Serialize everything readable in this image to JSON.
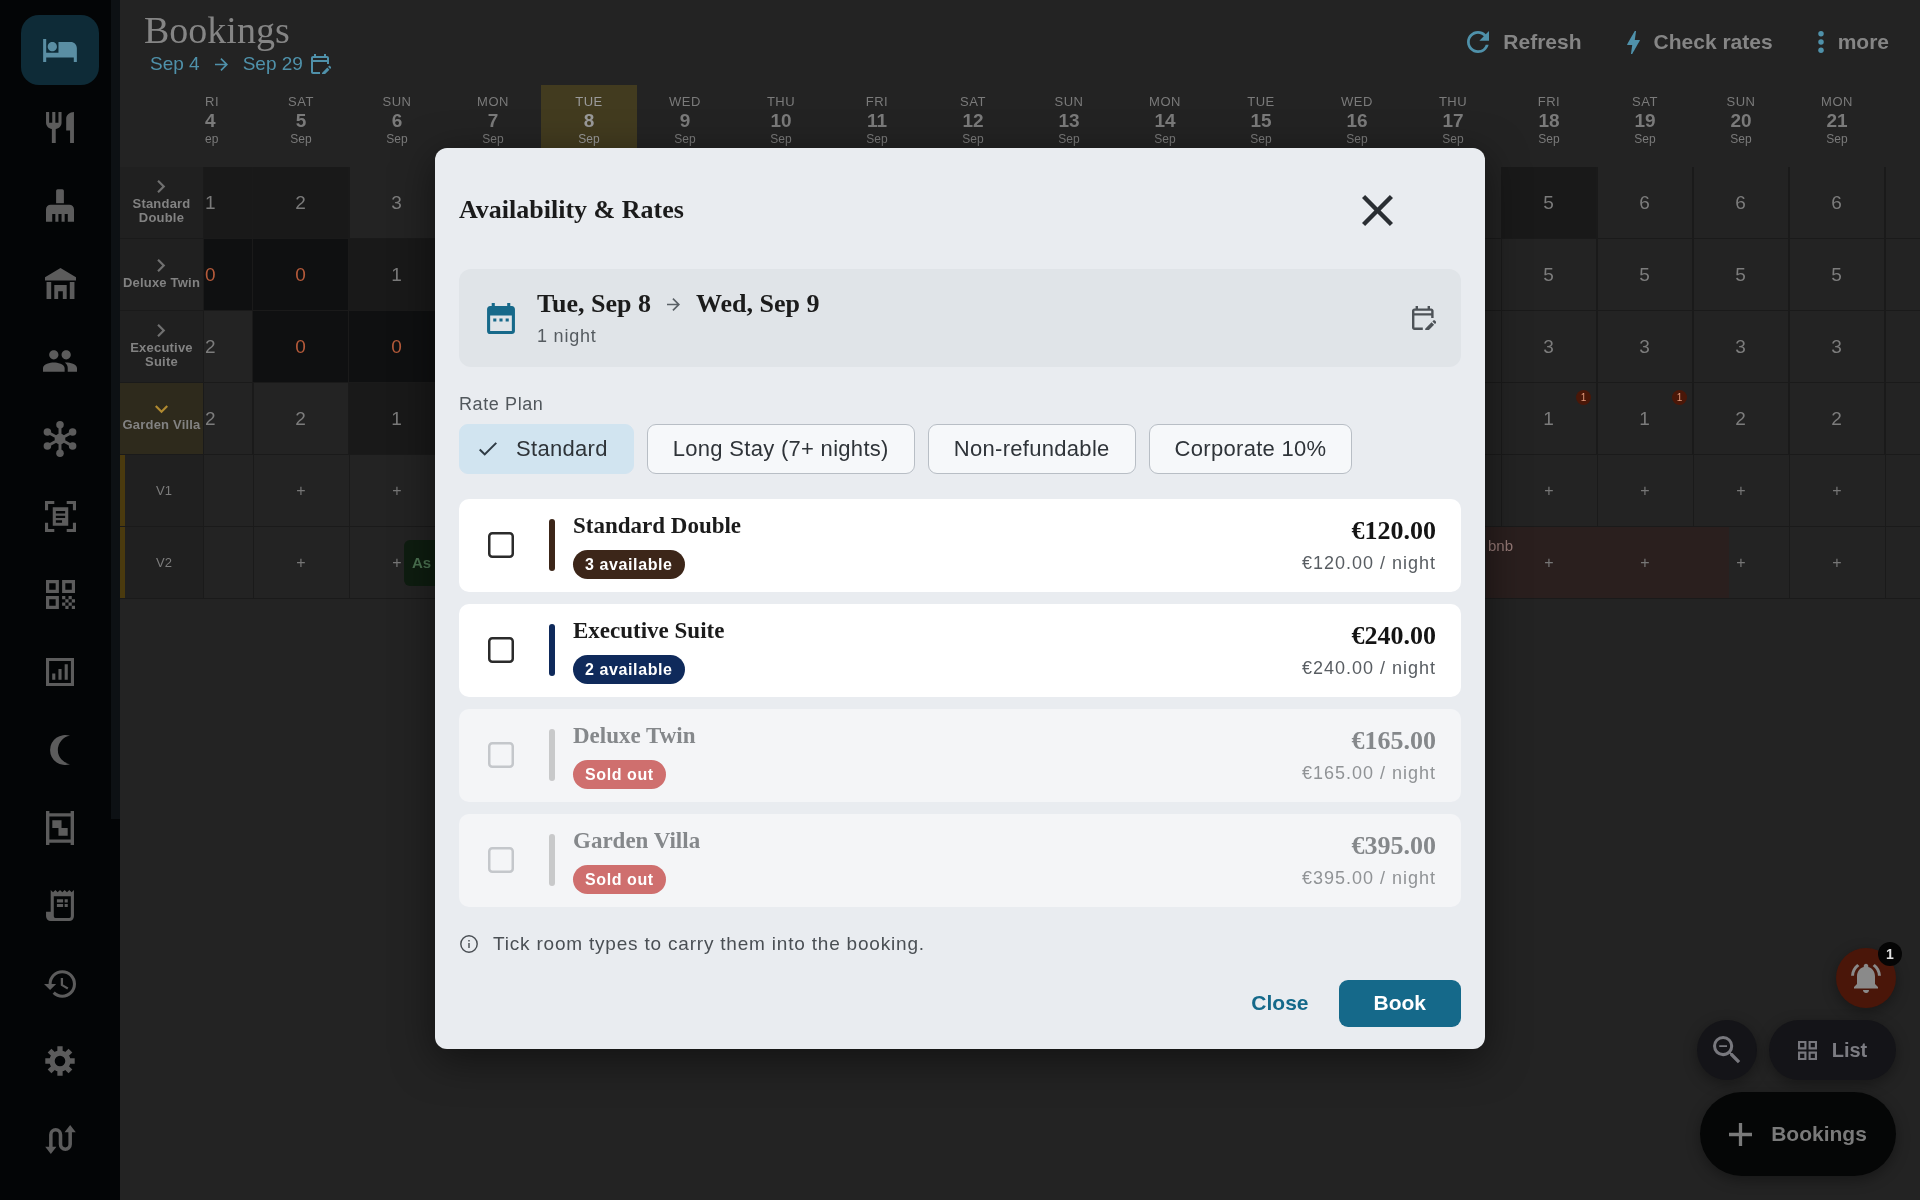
{
  "sidebar": {
    "items": [
      {
        "selected": true
      },
      {
        "selected": false
      },
      {
        "selected": false
      },
      {
        "selected": false
      },
      {
        "selected": false
      },
      {
        "selected": false
      },
      {
        "selected": false
      },
      {
        "selected": false
      },
      {
        "selected": false
      },
      {
        "selected": false
      },
      {
        "selected": false
      },
      {
        "selected": false
      },
      {
        "selected": false
      },
      {
        "selected": false
      },
      {
        "selected": false
      }
    ]
  },
  "header": {
    "title": "Bookings",
    "range_start": "Sep 4",
    "range_end": "Sep 29"
  },
  "toolbar": [
    "Refresh",
    "Check rates",
    "more"
  ],
  "calendar": {
    "days": [
      {
        "weekday": "RI",
        "day": "4",
        "month": "ep",
        "today": false
      },
      {
        "weekday": "SAT",
        "day": "5",
        "month": "Sep",
        "today": false
      },
      {
        "weekday": "SUN",
        "day": "6",
        "month": "Sep",
        "today": false
      },
      {
        "weekday": "MON",
        "day": "7",
        "month": "Sep",
        "today": false
      },
      {
        "weekday": "TUE",
        "day": "8",
        "month": "Sep",
        "today": true
      },
      {
        "weekday": "WED",
        "day": "9",
        "month": "Sep",
        "today": false
      },
      {
        "weekday": "THU",
        "day": "10",
        "month": "Sep",
        "today": false
      },
      {
        "weekday": "FRI",
        "day": "11",
        "month": "Sep",
        "today": false
      },
      {
        "weekday": "SAT",
        "day": "12",
        "month": "Sep",
        "today": false
      },
      {
        "weekday": "SUN",
        "day": "13",
        "month": "Sep",
        "today": false
      },
      {
        "weekday": "MON",
        "day": "14",
        "month": "Sep",
        "today": false
      },
      {
        "weekday": "TUE",
        "day": "15",
        "month": "Sep",
        "today": false
      },
      {
        "weekday": "WED",
        "day": "16",
        "month": "Sep",
        "today": false
      },
      {
        "weekday": "THU",
        "day": "17",
        "month": "Sep",
        "today": false
      },
      {
        "weekday": "FRI",
        "day": "18",
        "month": "Sep",
        "today": false
      },
      {
        "weekday": "SAT",
        "day": "19",
        "month": "Sep",
        "today": false
      },
      {
        "weekday": "SUN",
        "day": "20",
        "month": "Sep",
        "today": false
      },
      {
        "weekday": "MON",
        "day": "21",
        "month": "Sep",
        "today": false
      }
    ],
    "rows": [
      {
        "label": "Standard Double",
        "expanded": false,
        "cells": [
          {
            "value": "1",
            "kind": "low"
          },
          {
            "value": "2",
            "kind": "low"
          },
          {
            "value": "3",
            "kind": "open"
          },
          {},
          {},
          {},
          {},
          {},
          {},
          {},
          {},
          {},
          {},
          {},
          {
            "value": "5",
            "kind": "low"
          },
          {
            "value": "6",
            "kind": "open"
          },
          {
            "value": "6",
            "kind": "open"
          },
          {
            "value": "6",
            "kind": "open"
          }
        ]
      },
      {
        "label": "Deluxe Twin",
        "expanded": false,
        "cells": [
          {
            "value": "0",
            "kind": "full"
          },
          {
            "value": "0",
            "kind": "full"
          },
          {
            "value": "1",
            "kind": "low"
          },
          {},
          {},
          {},
          {},
          {},
          {},
          {},
          {},
          {},
          {},
          {},
          {
            "value": "5",
            "kind": "open"
          },
          {
            "value": "5",
            "kind": "open"
          },
          {
            "value": "5",
            "kind": "open"
          },
          {
            "value": "5",
            "kind": "open"
          }
        ]
      },
      {
        "label": "Executive Suite",
        "expanded": false,
        "cells": [
          {
            "value": "2",
            "kind": "open"
          },
          {
            "value": "0",
            "kind": "full"
          },
          {
            "value": "0",
            "kind": "full"
          },
          {},
          {},
          {},
          {},
          {},
          {},
          {},
          {},
          {},
          {},
          {},
          {
            "value": "3",
            "kind": "open"
          },
          {
            "value": "3",
            "kind": "open"
          },
          {
            "value": "3",
            "kind": "open"
          },
          {
            "value": "3",
            "kind": "open"
          }
        ]
      },
      {
        "label": "Garden Villa",
        "expanded": true,
        "cells": [
          {
            "value": "2",
            "kind": "open"
          },
          {
            "value": "2",
            "kind": "open"
          },
          {
            "value": "1",
            "kind": "low"
          },
          {},
          {},
          {},
          {},
          {},
          {},
          {},
          {},
          {},
          {},
          {},
          {
            "value": "1",
            "kind": "open",
            "badge": "1"
          },
          {
            "value": "1",
            "kind": "open",
            "badge": "1"
          },
          {
            "value": "2",
            "kind": "open"
          },
          {
            "value": "2",
            "kind": "open"
          }
        ],
        "children": [
          {
            "label": "V1",
            "cells": [
              {},
              {
                "value": "+",
                "kind": "add"
              },
              {
                "value": "+",
                "kind": "add"
              },
              {},
              {},
              {},
              {},
              {},
              {},
              {},
              {},
              {},
              {},
              {},
              {
                "value": "+",
                "kind": "add"
              },
              {
                "value": "+",
                "kind": "add"
              },
              {
                "value": "+",
                "kind": "add"
              },
              {
                "value": "+",
                "kind": "add"
              }
            ]
          },
          {
            "label": "V2",
            "cells": [
              {},
              {
                "value": "+",
                "kind": "add"
              },
              {
                "value": "+",
                "kind": "add"
              },
              {},
              {},
              {},
              {},
              {},
              {},
              {},
              {},
              {},
              {},
              {},
              {
                "value": "+",
                "kind": "add"
              },
              {
                "value": "+",
                "kind": "add"
              },
              {
                "value": "+",
                "kind": "add"
              },
              {
                "value": "+",
                "kind": "add"
              }
            ],
            "bookings": [
              {
                "label": "As",
                "color": "#0e1d10"
              },
              {
                "label": "bnb",
                "color": "#2a1f1e"
              }
            ]
          }
        ]
      }
    ]
  },
  "dialog": {
    "title": "Availability & Rates",
    "stay": {
      "check_in": "Tue, Sep 8",
      "check_out": "Wed, Sep 9",
      "nights": "1 night"
    },
    "rate_plan": {
      "label": "Rate Plan",
      "options": [
        {
          "label": "Standard",
          "selected": true
        },
        {
          "label": "Long Stay (7+ nights)",
          "selected": false
        },
        {
          "label": "Non-refundable",
          "selected": false
        },
        {
          "label": "Corporate 10%",
          "selected": false
        }
      ]
    },
    "rooms": [
      {
        "name": "Standard Double",
        "badge": "3 available",
        "price": "€120.00",
        "per_night": "€120.00 / night",
        "color": "#3c2619",
        "checked": false,
        "disabled": false
      },
      {
        "name": "Executive Suite",
        "badge": "2 available",
        "price": "€240.00",
        "per_night": "€240.00 / night",
        "color": "#0f2a5b",
        "checked": false,
        "disabled": false
      },
      {
        "name": "Deluxe Twin",
        "badge": "Sold out",
        "price": "€165.00",
        "per_night": "€165.00 / night",
        "color": "#c8c9ca",
        "checked": false,
        "disabled": true
      },
      {
        "name": "Garden Villa",
        "badge": "Sold out",
        "price": "€395.00",
        "per_night": "€395.00 / night",
        "color": "#c8c9ca",
        "checked": false,
        "disabled": true
      }
    ],
    "note": "Tick room types to carry them into the booking.",
    "buttons": [
      {
        "label": "Close",
        "kind": "text"
      },
      {
        "label": "Book",
        "kind": "primary"
      }
    ]
  },
  "floating_buttons": {
    "notification_count": "1",
    "view_toggle": "List",
    "new_booking": "Bookings"
  }
}
